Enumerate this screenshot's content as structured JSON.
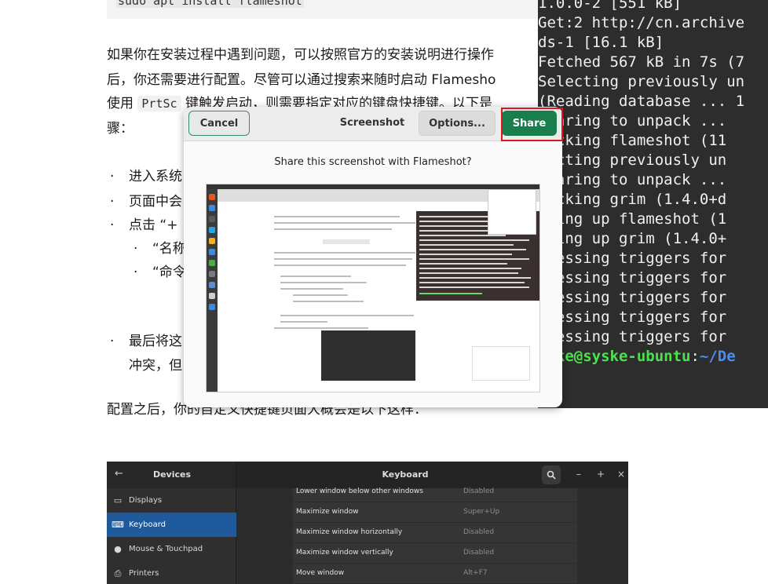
{
  "article": {
    "code_top": "sudo apt install flameshot",
    "para_lines": [
      "如果你在安装过程中遇到问题，可以按照官方的安装说明进行操作",
      "后，你还需要进行配置。尽管可以通过搜索来随时启动 Flamesho",
      "骤："
    ],
    "para_line3_pre": "使用 ",
    "para_line3_code": "PrtSc",
    "para_line3_post": " 键触发启动，则需要指定对应的键盘快捷键。以下是",
    "bullets": [
      "进入系统",
      "页面中会",
      "点击 “+"
    ],
    "sub_bullets": [
      "“名称",
      "“命令"
    ],
    "bullet_last_1": "最后将这",
    "bullet_last_2": "冲突，但",
    "after_text": "配置之后，你的自定义快捷键页面大概会是以下这样："
  },
  "terminal": {
    "lines": [
      "1.0.0-2 [551 kB]",
      "Get:2 http://cn.archive",
      "ds-1 [16.1 kB]",
      "Fetched 567 kB in 7s (7",
      "Selecting previously un",
      "(Reading database ... 1",
      "eparing to unpack ...",
      "packing flameshot (11",
      "lecting previously un",
      "eparing to unpack ...",
      "packing grim (1.4.0+d",
      "tting up flameshot (1",
      "tting up grim (1.4.0+",
      "ocessing triggers for",
      "ocessing triggers for",
      "ocessing triggers for",
      "ocessing triggers for",
      "ocessing triggers for"
    ],
    "prompt_user": "yske@syske-ubuntu",
    "prompt_sep": ":",
    "prompt_path": "~/De"
  },
  "dialog": {
    "cancel_label": "Cancel",
    "title": "Screenshot",
    "options_label": "Options...",
    "share_label": "Share",
    "subtitle": "Share this screenshot with Flameshot?",
    "highlight_color": "#e0141e",
    "share_color": "#1a7d4c"
  },
  "settings": {
    "back_icon": "←",
    "devices_title": "Devices",
    "keyboard_title": "Keyboard",
    "search_icon": "search-icon",
    "window_controls": [
      "–",
      "+",
      "×"
    ],
    "sidebar": [
      {
        "icon": "▭",
        "label": "Displays"
      },
      {
        "icon": "⌨",
        "label": "Keyboard"
      },
      {
        "icon": "●",
        "label": "Mouse & Touchpad"
      },
      {
        "icon": "⎙",
        "label": "Printers"
      }
    ],
    "shortcuts": [
      {
        "name": "Lower window below other windows",
        "value": "Disabled"
      },
      {
        "name": "Maximize window",
        "value": "Super+Up"
      },
      {
        "name": "Maximize window horizontally",
        "value": "Disabled"
      },
      {
        "name": "Maximize window vertically",
        "value": "Disabled"
      },
      {
        "name": "Move window",
        "value": "Alt+F7"
      }
    ]
  }
}
